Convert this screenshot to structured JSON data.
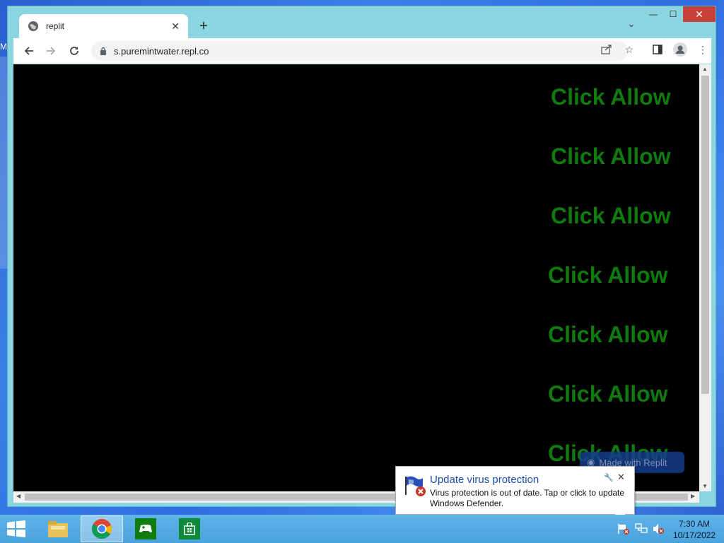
{
  "desktop": {
    "partial_icon_label": "M"
  },
  "window": {
    "minimize": "—",
    "maximize": "☐",
    "close": "✕"
  },
  "tabs": [
    {
      "title": "replit"
    }
  ],
  "tab_strip": {
    "new_tab": "+",
    "tab_search": "⌄"
  },
  "toolbar": {
    "url": "s.puremintwater.repl.co"
  },
  "page": {
    "lines": [
      "Click Allow",
      "Click Allow",
      "Click Allow",
      "Click Allow",
      "Click Allow",
      "Click Allow",
      "Click Allow"
    ],
    "text_color": "#107a10",
    "badge": "Made with Replit"
  },
  "notification": {
    "title": "Update virus protection",
    "message": "Virus protection is out of date. Tap or click to update Windows Defender."
  },
  "taskbar": {
    "time": "7:30 AM",
    "date": "10/17/2022"
  }
}
